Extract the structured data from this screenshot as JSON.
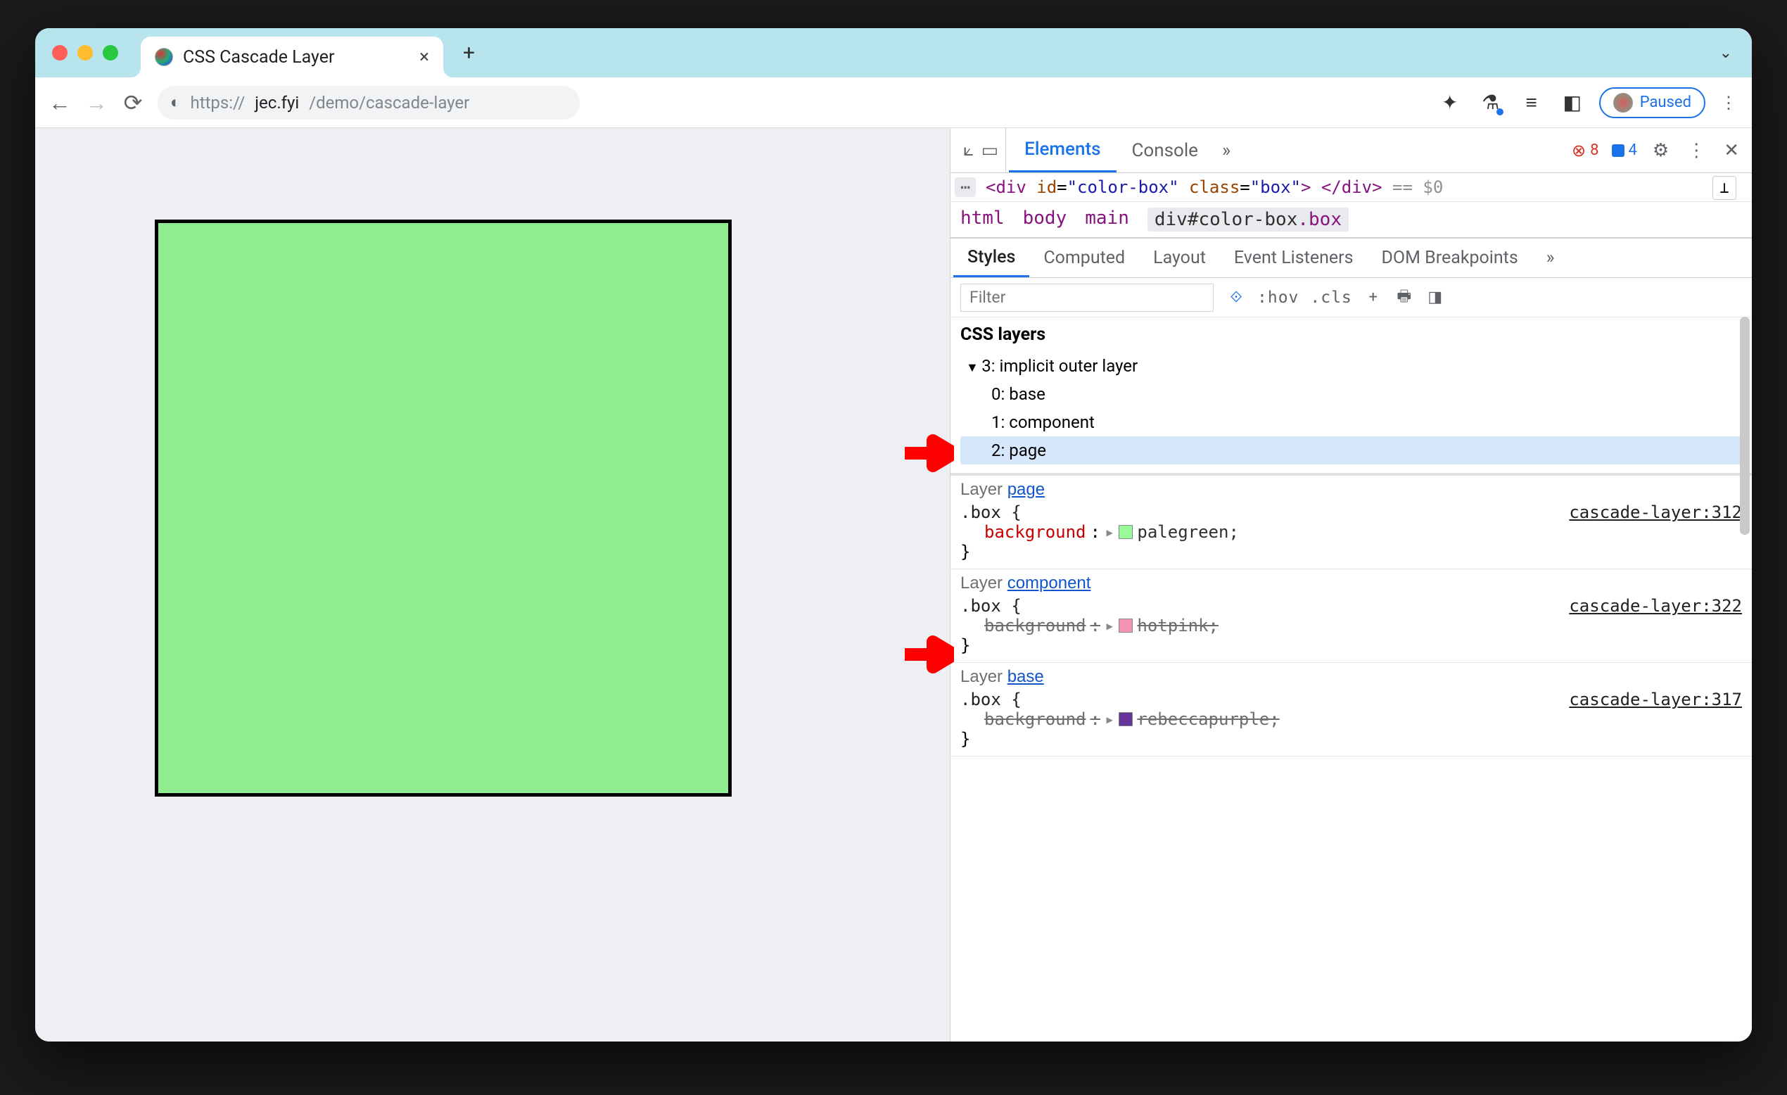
{
  "tab": {
    "title": "CSS Cascade Layer",
    "close": "×",
    "newtab": "+"
  },
  "address": {
    "scheme": "https://",
    "host": "jec.fyi",
    "path": "/demo/cascade-layer",
    "paused": "Paused"
  },
  "devtools_tabs": {
    "elements": "Elements",
    "console": "Console",
    "more": "»"
  },
  "counts": {
    "errors": "8",
    "messages": "4"
  },
  "dom": {
    "raw_open": "<div",
    "id_attr": "id",
    "id_val": "\"color-box\"",
    "class_attr": "class",
    "class_val": "\"box\"",
    "raw_mid": ">",
    "raw_close": "</div>",
    "eq": "== $0"
  },
  "crumbs": {
    "html": "html",
    "body": "body",
    "main": "main",
    "sel": "div#color-box",
    "sel_cls": ".box"
  },
  "subtabs": {
    "styles": "Styles",
    "computed": "Computed",
    "layout": "Layout",
    "events": "Event Listeners",
    "dom": "DOM Breakpoints",
    "more": "»"
  },
  "filter": {
    "placeholder": "Filter",
    "hov": ":hov",
    "cls": ".cls",
    "plus": "+"
  },
  "layers": {
    "title": "CSS layers",
    "root": "3: implicit outer layer",
    "items": [
      "0: base",
      "1: component",
      "2: page"
    ]
  },
  "rules": [
    {
      "layer_prefix": "Layer ",
      "layer_name": "page",
      "selector": ".box {",
      "src": "cascade-layer:312",
      "prop": "background",
      "val": "palegreen;",
      "struck": false,
      "swatch": "sw-palegreen",
      "close": "}"
    },
    {
      "layer_prefix": "Layer ",
      "layer_name": "component",
      "selector": ".box {",
      "src": "cascade-layer:322",
      "prop": "background",
      "val": "hotpink;",
      "struck": true,
      "swatch": "sw-hotpink",
      "close": "}"
    },
    {
      "layer_prefix": "Layer ",
      "layer_name": "base",
      "selector": ".box {",
      "src": "cascade-layer:317",
      "prop": "background",
      "val": "rebeccapurple;",
      "struck": true,
      "swatch": "sw-rebecca",
      "close": "}"
    }
  ]
}
